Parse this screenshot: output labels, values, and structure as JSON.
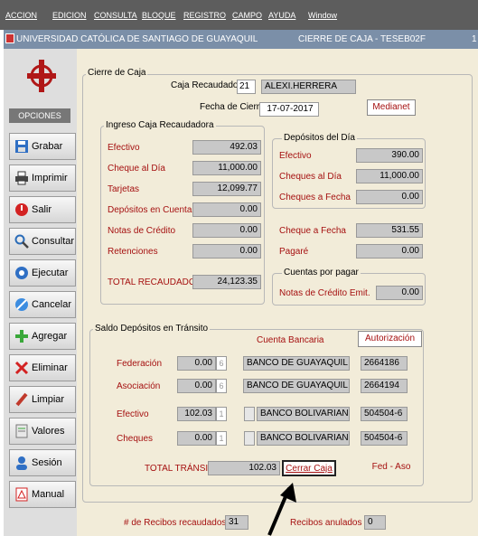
{
  "menu": [
    "ACCION",
    "EDICION",
    "CONSULTA",
    "BLOQUE",
    "REGISTRO",
    "CAMPO",
    "AYUDA",
    "Window"
  ],
  "titlebar": {
    "app": "UNIVERSIDAD CATÓLICA DE SANTIAGO DE GUAYAQUIL",
    "form": "CIERRE DE CAJA - TESEB02F",
    "edge": "1"
  },
  "sidebar": {
    "heading": "OPCIONES",
    "buttons": [
      {
        "label": "Grabar",
        "icon": "floppy-icon"
      },
      {
        "label": "Imprimir",
        "icon": "printer-icon"
      },
      {
        "label": "Salir",
        "icon": "exit-icon"
      },
      {
        "label": "Consultar",
        "icon": "magnifier-icon"
      },
      {
        "label": "Ejecutar",
        "icon": "execute-icon"
      },
      {
        "label": "Cancelar",
        "icon": "cancel-icon"
      },
      {
        "label": "Agregar",
        "icon": "plus-icon"
      },
      {
        "label": "Eliminar",
        "icon": "x-icon"
      },
      {
        "label": "Limpiar",
        "icon": "eraser-icon"
      },
      {
        "label": "Valores",
        "icon": "document-icon"
      },
      {
        "label": "Sesión",
        "icon": "user-icon"
      },
      {
        "label": "Manual",
        "icon": "pdf-icon"
      }
    ]
  },
  "cierre": {
    "title": "Cierre de Caja",
    "caja_label": "Caja Recaudadodra",
    "caja_num": "21",
    "caja_name": "ALEXI.HERRERA",
    "fecha_label": "Fecha de Cierre",
    "fecha": "17-07-2017",
    "medianet": "Medianet"
  },
  "ingreso": {
    "title": "Ingreso Caja Recaudadora",
    "rows": [
      {
        "label": "Efectivo",
        "value": "492.03"
      },
      {
        "label": "Cheque al Día",
        "value": "11,000.00"
      },
      {
        "label": "Tarjetas",
        "value": "12,099.77"
      },
      {
        "label": "Depósitos en Cuenta",
        "value": "0.00"
      },
      {
        "label": "Notas de Crédito",
        "value": "0.00"
      },
      {
        "label": "Retenciones",
        "value": "0.00"
      }
    ],
    "total_label": "TOTAL RECAUDADO",
    "total": "24,123.35"
  },
  "depositos": {
    "title": "Depósitos del Día",
    "rows": [
      {
        "label": "Efectivo",
        "value": "390.00"
      },
      {
        "label": "Cheques al Día",
        "value": "11,000.00"
      },
      {
        "label": "Cheques a Fecha",
        "value": "0.00"
      }
    ]
  },
  "otros": [
    {
      "label": "Cheque a Fecha",
      "value": "531.55"
    },
    {
      "label": "Pagaré",
      "value": "0.00"
    }
  ],
  "cuentas": {
    "title": "Cuentas por pagar",
    "label": "Notas de Crédito Emit.",
    "value": "0.00"
  },
  "transito": {
    "title": "Saldo Depósitos en Tránsito",
    "col_cuenta": "Cuenta Bancaria",
    "col_auth": "Autorización",
    "rows": [
      {
        "label": "Federación",
        "value": "0.00",
        "code": "6",
        "bank": "BANCO DE GUAYAQUIL",
        "auth": "2664186"
      },
      {
        "label": "Asociación",
        "value": "0.00",
        "code": "6",
        "bank": "BANCO DE GUAYAQUIL",
        "auth": "2664194"
      },
      {
        "label": "Efectivo",
        "value": "102.03",
        "code": "1",
        "bank": "BANCO BOLIVARIANO",
        "auth": "504504-6"
      },
      {
        "label": "Cheques",
        "value": "0.00",
        "code": "1",
        "bank": "BANCO BOLIVARIANO",
        "auth": "504504-6"
      }
    ],
    "total_label": "TOTAL TRÁNSITO",
    "total": "102.03",
    "cerrar": "Cerrar Caja",
    "fedaso": "Fed - Aso"
  },
  "footer": {
    "recaudados_label": "# de Recibos recaudados",
    "recaudados": "31",
    "anulados_label": "Recibos anulados",
    "anulados": "0"
  }
}
